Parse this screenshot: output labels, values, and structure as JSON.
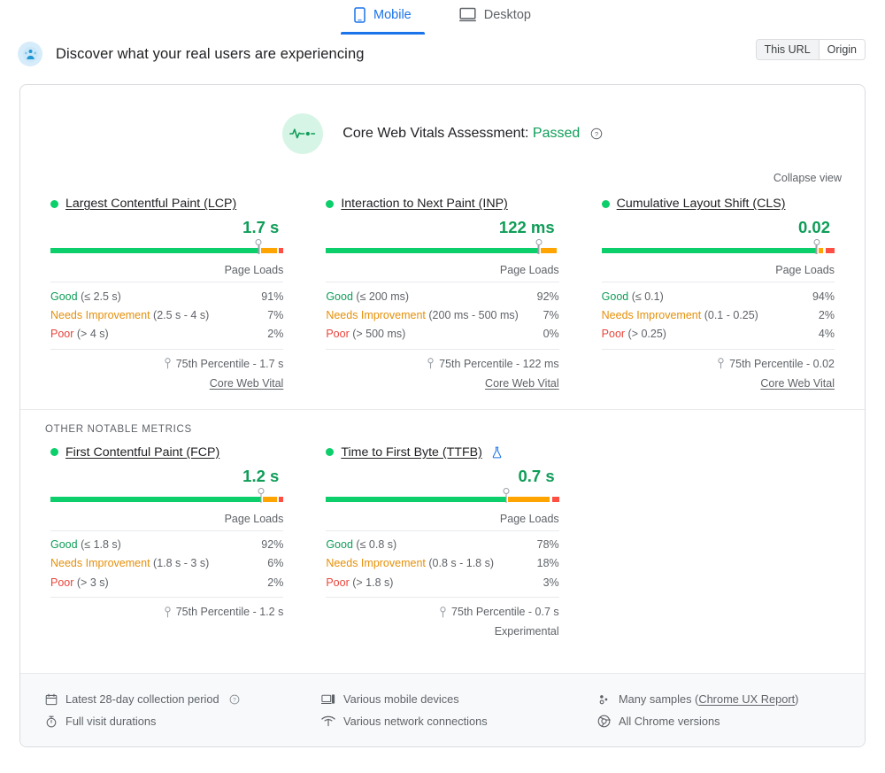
{
  "tabs": [
    {
      "label": "Mobile",
      "icon": "mobile-icon",
      "active": true
    },
    {
      "label": "Desktop",
      "icon": "desktop-icon",
      "active": false
    }
  ],
  "header": {
    "avatar_icon": "real-users-icon",
    "headline": "Discover what your real users are experiencing",
    "scope": {
      "options": [
        "This URL",
        "Origin"
      ],
      "selected": "This URL"
    }
  },
  "assessment": {
    "badge_icon": "pulse-icon",
    "label": "Core Web Vitals Assessment:",
    "status": "Passed",
    "help_icon": "help-circle-icon",
    "collapse_label": "Collapse view"
  },
  "colors": {
    "good": "#0cce6b",
    "needs_improvement": "#ffa400",
    "poor": "#ff4e42",
    "good_text": "#0f9d58",
    "ni_text": "#e5900a",
    "poor_text": "#e8453c",
    "accent": "#1a73e8"
  },
  "labels": {
    "page_loads": "Page Loads",
    "good": "Good",
    "needs_improvement": "Needs Improvement",
    "poor": "Poor",
    "core_web_vital": "Core Web Vital",
    "experimental": "Experimental",
    "percentile_prefix": "75th Percentile - ",
    "other_metrics_heading": "OTHER NOTABLE METRICS"
  },
  "chart_data": {
    "type": "bar",
    "title": "Core Web Vitals Assessment: Passed",
    "note": "Stacked distribution bars (% of page loads) per metric, with 75th-percentile marker",
    "categories": [
      "Good",
      "Needs Improvement",
      "Poor"
    ],
    "series": [
      {
        "name": "Largest Contentful Paint (LCP)",
        "values": [
          91,
          7,
          2
        ],
        "p75": "1.7 s",
        "marker_pct": 91
      },
      {
        "name": "Interaction to Next Paint (INP)",
        "values": [
          92,
          7,
          0
        ],
        "p75": "122 ms",
        "marker_pct": 92
      },
      {
        "name": "Cumulative Layout Shift (CLS)",
        "values": [
          94,
          2,
          4
        ],
        "p75": "0.02",
        "marker_pct": 94
      },
      {
        "name": "First Contentful Paint (FCP)",
        "values": [
          92,
          6,
          2
        ],
        "p75": "1.2 s",
        "marker_pct": 92
      },
      {
        "name": "Time to First Byte (TTFB)",
        "values": [
          78,
          18,
          3
        ],
        "p75": "0.7 s",
        "marker_pct": 78
      }
    ],
    "ylabel": "Page Loads",
    "ylim": [
      0,
      100
    ],
    "legend": [
      "Good",
      "Needs Improvement",
      "Poor"
    ]
  },
  "core_metrics": [
    {
      "title": "Largest Contentful Paint (LCP)",
      "status": "good",
      "value": "1.7 s",
      "marker_pct": 91,
      "bar": {
        "good": 91,
        "ni": 7,
        "poor": 2
      },
      "buckets": [
        {
          "label": "Good",
          "range": "(≤ 2.5 s)",
          "pct": "91%",
          "cls": "lbl-good"
        },
        {
          "label": "Needs Improvement",
          "range": "(2.5 s - 4 s)",
          "pct": "7%",
          "cls": "lbl-ni"
        },
        {
          "label": "Poor",
          "range": "(> 4 s)",
          "pct": "2%",
          "cls": "lbl-poor"
        }
      ],
      "percentile": "75th Percentile - 1.7 s",
      "footnote": "Core Web Vital",
      "footnote_kind": "link",
      "experimental": false
    },
    {
      "title": "Interaction to Next Paint (INP)",
      "status": "good",
      "value": "122 ms",
      "marker_pct": 92,
      "bar": {
        "good": 92,
        "ni": 7,
        "poor": 0
      },
      "buckets": [
        {
          "label": "Good",
          "range": "(≤ 200 ms)",
          "pct": "92%",
          "cls": "lbl-good"
        },
        {
          "label": "Needs Improvement",
          "range": "(200 ms - 500 ms)",
          "pct": "7%",
          "cls": "lbl-ni"
        },
        {
          "label": "Poor",
          "range": "(> 500 ms)",
          "pct": "0%",
          "cls": "lbl-poor"
        }
      ],
      "percentile": "75th Percentile - 122 ms",
      "footnote": "Core Web Vital",
      "footnote_kind": "link",
      "experimental": false
    },
    {
      "title": "Cumulative Layout Shift (CLS)",
      "status": "good",
      "value": "0.02",
      "marker_pct": 94,
      "bar": {
        "good": 94,
        "ni": 2,
        "poor": 4
      },
      "buckets": [
        {
          "label": "Good",
          "range": "(≤ 0.1)",
          "pct": "94%",
          "cls": "lbl-good"
        },
        {
          "label": "Needs Improvement",
          "range": "(0.1 - 0.25)",
          "pct": "2%",
          "cls": "lbl-ni"
        },
        {
          "label": "Poor",
          "range": "(> 0.25)",
          "pct": "4%",
          "cls": "lbl-poor"
        }
      ],
      "percentile": "75th Percentile - 0.02",
      "footnote": "Core Web Vital",
      "footnote_kind": "link",
      "experimental": false
    }
  ],
  "other_metrics": [
    {
      "title": "First Contentful Paint (FCP)",
      "status": "good",
      "value": "1.2 s",
      "marker_pct": 92,
      "bar": {
        "good": 92,
        "ni": 6,
        "poor": 2
      },
      "buckets": [
        {
          "label": "Good",
          "range": "(≤ 1.8 s)",
          "pct": "92%",
          "cls": "lbl-good"
        },
        {
          "label": "Needs Improvement",
          "range": "(1.8 s - 3 s)",
          "pct": "6%",
          "cls": "lbl-ni"
        },
        {
          "label": "Poor",
          "range": "(> 3 s)",
          "pct": "2%",
          "cls": "lbl-poor"
        }
      ],
      "percentile": "75th Percentile - 1.2 s",
      "footnote": "",
      "footnote_kind": "none",
      "experimental": false
    },
    {
      "title": "Time to First Byte (TTFB)",
      "status": "good",
      "value": "0.7 s",
      "marker_pct": 78,
      "bar": {
        "good": 78,
        "ni": 18,
        "poor": 3
      },
      "buckets": [
        {
          "label": "Good",
          "range": "(≤ 0.8 s)",
          "pct": "78%",
          "cls": "lbl-good"
        },
        {
          "label": "Needs Improvement",
          "range": "(0.8 s - 1.8 s)",
          "pct": "18%",
          "cls": "lbl-ni"
        },
        {
          "label": "Poor",
          "range": "(> 1.8 s)",
          "pct": "3%",
          "cls": "lbl-poor"
        }
      ],
      "percentile": "75th Percentile - 0.7 s",
      "footnote": "Experimental",
      "footnote_kind": "text",
      "experimental": true
    }
  ],
  "footer": {
    "columns": [
      [
        {
          "icon": "calendar-icon",
          "text": "Latest 28-day collection period",
          "help": true
        },
        {
          "icon": "stopwatch-icon",
          "text": "Full visit durations",
          "help": false
        }
      ],
      [
        {
          "icon": "devices-icon",
          "text": "Various mobile devices",
          "help": false
        },
        {
          "icon": "wifi-icon",
          "text": "Various network connections",
          "help": false
        }
      ],
      [
        {
          "icon": "samples-icon",
          "text": "Many samples (",
          "link": "Chrome UX Report",
          "text_after": ")",
          "help": false
        },
        {
          "icon": "chrome-icon",
          "text": "All Chrome versions",
          "help": false
        }
      ]
    ]
  }
}
